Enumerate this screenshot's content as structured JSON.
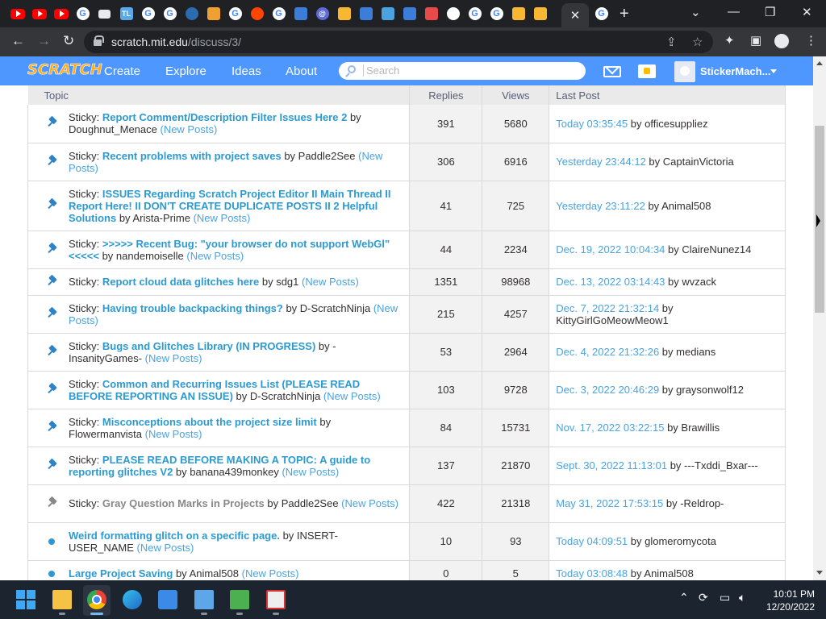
{
  "browser": {
    "active_tab_close": "✕",
    "new_tab": "+",
    "url_host": "scratch.mit.edu",
    "url_path": "/discuss/3/",
    "win_minimize": "—",
    "win_restore": "❐",
    "win_close": "✕",
    "tab_dropdown": "⌄"
  },
  "scratch_nav": {
    "logo": "SCRATCH",
    "links": [
      "Create",
      "Explore",
      "Ideas",
      "About"
    ],
    "search_placeholder": "Search",
    "username": "StickerMach..."
  },
  "table": {
    "headers": [
      "Topic",
      "Replies",
      "Views",
      "Last Post"
    ],
    "rows": [
      {
        "prefix": "Sticky: ",
        "title": "Report Comment/Description Filter Issues Here 2",
        "by": " by Doughnut_Menace ",
        "new": "(New Posts)",
        "replies": "391",
        "views": "5680",
        "date": "Today 03:35:45",
        "lastby": " by officesuppliez"
      },
      {
        "prefix": "Sticky: ",
        "title": "Recent problems with project saves",
        "by": " by Paddle2See ",
        "new": "(New Posts)",
        "replies": "306",
        "views": "6916",
        "date": "Yesterday 23:44:12",
        "lastby": " by CaptainVictoria"
      },
      {
        "prefix": "Sticky: ",
        "title": "ISSUES Regarding Scratch Project Editor II Main Thread II Report Here! II DON'T CREATE DUPLICATE POSTS II 2 Helpful Solutions",
        "by": " by Arista-Prime ",
        "new": "(New Posts)",
        "replies": "41",
        "views": "725",
        "date": "Yesterday 23:11:22",
        "lastby": " by Animal508"
      },
      {
        "prefix": "Sticky: ",
        "title": ">>>>> Recent Bug: \"your browser do not support WebGl\" <<<<<",
        "by": " by nandemoiselle ",
        "new": "(New Posts)",
        "replies": "44",
        "views": "2234",
        "date": "Dec. 19, 2022 10:04:34",
        "lastby": " by ClaireNunez14"
      },
      {
        "prefix": "Sticky: ",
        "title": "Report cloud data glitches here",
        "by": " by sdg1 ",
        "new": "(New Posts)",
        "replies": "1351",
        "views": "98968",
        "date": "Dec. 13, 2022 03:14:43",
        "lastby": " by wvzack"
      },
      {
        "prefix": "Sticky: ",
        "title": "Having trouble backpacking things?",
        "by": " by D-ScratchNinja ",
        "new": "(New Posts)",
        "replies": "215",
        "views": "4257",
        "date": "Dec. 7, 2022 21:32:14",
        "lastby": " by KittyGirlGoMeowMeow1"
      },
      {
        "prefix": "Sticky: ",
        "title": "Bugs and Glitches Library (IN PROGRESS)",
        "by": " by -InsanityGames- ",
        "new": "(New Posts)",
        "replies": "53",
        "views": "2964",
        "date": "Dec. 4, 2022 21:32:26",
        "lastby": " by medians"
      },
      {
        "prefix": "Sticky: ",
        "title": "Common and Recurring Issues List (PLEASE READ BEFORE REPORTING AN ISSUE)",
        "by": " by D-ScratchNinja ",
        "new": "(New Posts)",
        "replies": "103",
        "views": "9728",
        "date": "Dec. 3, 2022 20:46:29",
        "lastby": " by graysonwolf12"
      },
      {
        "prefix": "Sticky: ",
        "title": "Misconceptions about the project size limit",
        "by": " by Flowermanvista ",
        "new": "(New Posts)",
        "replies": "84",
        "views": "15731",
        "date": "Nov. 17, 2022 03:22:15",
        "lastby": " by Brawillis"
      },
      {
        "prefix": "Sticky: ",
        "title": "PLEASE READ BEFORE MAKING A TOPIC: A guide to reporting glitches V2",
        "by": " by banana439monkey ",
        "new": "(New Posts)",
        "replies": "137",
        "views": "21870",
        "date": "Sept. 30, 2022 11:13:01",
        "lastby": " by ---Txddi_Bxar---"
      },
      {
        "prefix": "Sticky: ",
        "title": "Gray Question Marks in Projects",
        "by": " by Paddle2See ",
        "new": "(New Posts)",
        "replies": "422",
        "views": "21318",
        "date": "May 31, 2022 17:53:15",
        "lastby": " by -Reldrop-"
      },
      {
        "prefix": "",
        "title": "Weird formatting glitch on a specific page.",
        "by": " by INSERT-USER_NAME ",
        "new": "(New Posts)",
        "replies": "10",
        "views": "93",
        "date": "Today 04:09:51",
        "lastby": " by glomeromycota"
      },
      {
        "prefix": "",
        "title": "Large Project Saving",
        "by": " by Animal508 ",
        "new": "(New Posts)",
        "replies": "0",
        "views": "5",
        "date": "Today 03:08:48",
        "lastby": " by Animal508"
      }
    ]
  },
  "taskbar": {
    "time": "10:01 PM",
    "date": "12/20/2022"
  },
  "colors": {
    "scratch_blue": "#4d97ff",
    "link_blue": "#2c9ad1",
    "pin_blue": "#2c83c6",
    "chrome_dark": "#202124"
  }
}
